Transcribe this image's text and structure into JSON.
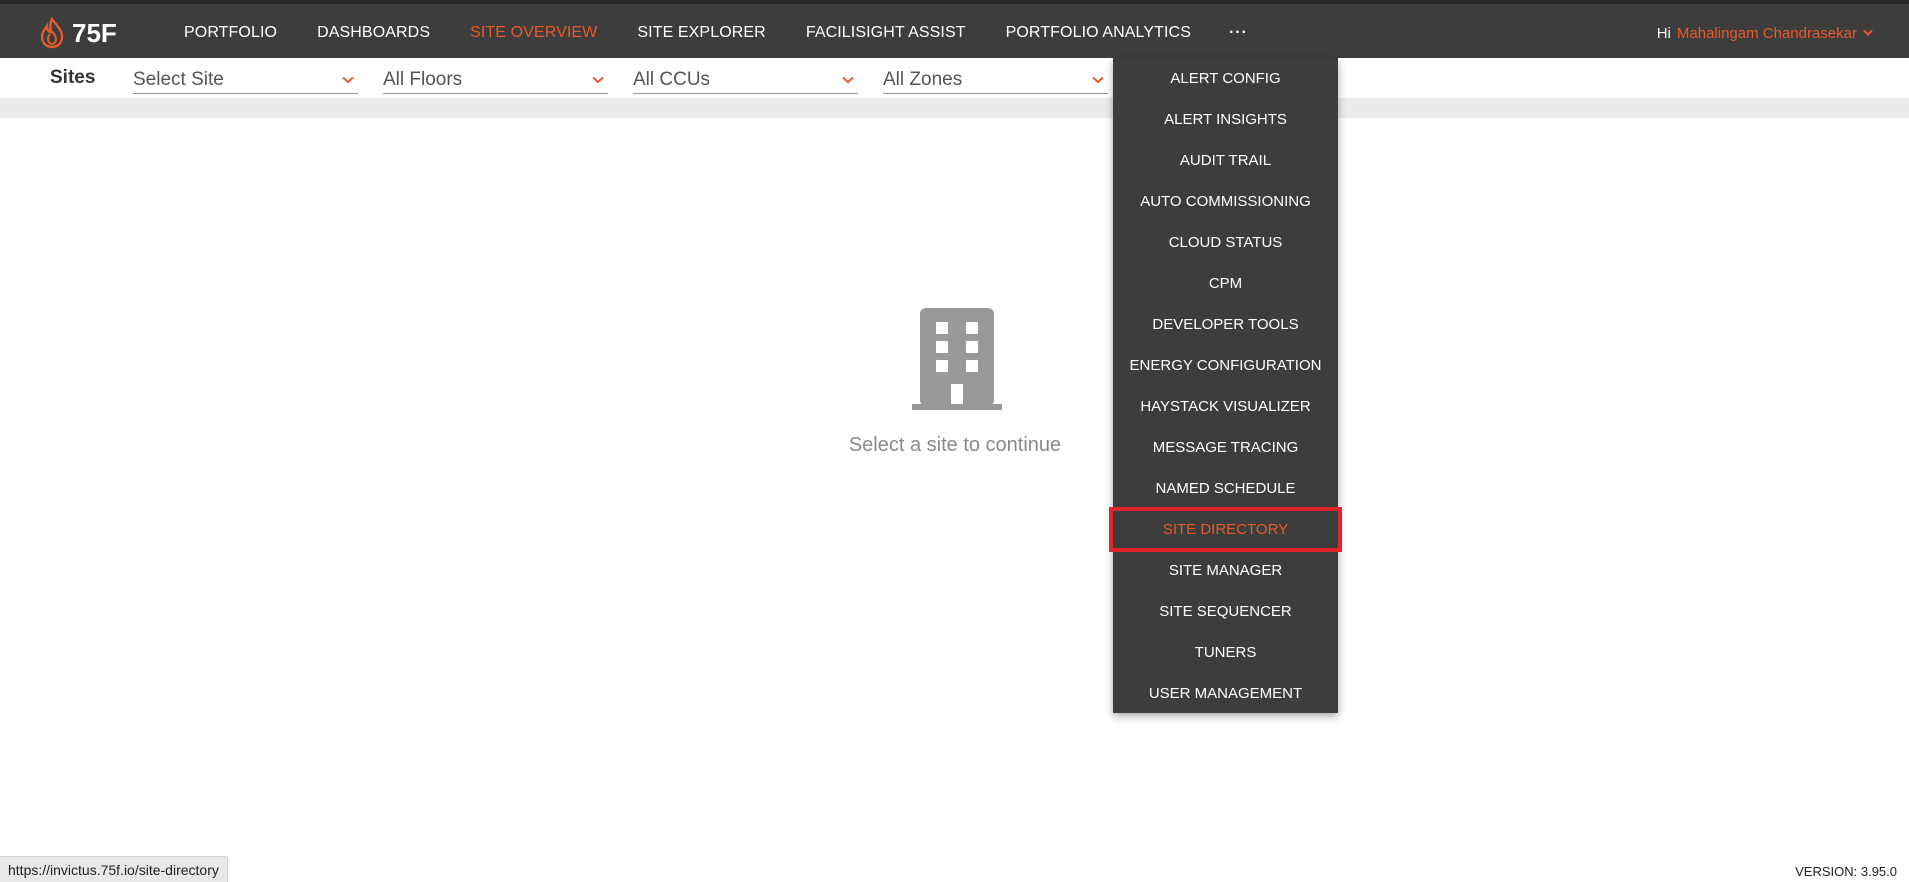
{
  "brand": {
    "logo_text": "75F",
    "accent_color": "#e95a2b"
  },
  "nav": {
    "items": [
      {
        "label": "PORTFOLIO",
        "active": false
      },
      {
        "label": "DASHBOARDS",
        "active": false
      },
      {
        "label": "SITE OVERVIEW",
        "active": true
      },
      {
        "label": "SITE EXPLORER",
        "active": false
      },
      {
        "label": "FACILISIGHT ASSIST",
        "active": false
      },
      {
        "label": "PORTFOLIO ANALYTICS",
        "active": false
      }
    ],
    "more_label": "···"
  },
  "user": {
    "greeting": "Hi",
    "name": "Mahalingam Chandrasekar"
  },
  "filters": {
    "sites_label": "Sites",
    "site": "Select Site",
    "floors": "All Floors",
    "ccus": "All CCUs",
    "zones": "All Zones"
  },
  "empty_state": {
    "message": "Select a site to continue",
    "icon": "building-icon"
  },
  "menu": {
    "items": [
      "ALERT CONFIG",
      "ALERT INSIGHTS",
      "AUDIT TRAIL",
      "AUTO COMMISSIONING",
      "CLOUD STATUS",
      "CPM",
      "DEVELOPER TOOLS",
      "ENERGY CONFIGURATION",
      "HAYSTACK VISUALIZER",
      "MESSAGE TRACING",
      "NAMED SCHEDULE",
      "SITE DIRECTORY",
      "SITE MANAGER",
      "SITE SEQUENCER",
      "TUNERS",
      "USER MANAGEMENT"
    ],
    "highlighted": "SITE DIRECTORY"
  },
  "status_url": "https://invictus.75f.io/site-directory",
  "version": "VERSION: 3.95.0"
}
